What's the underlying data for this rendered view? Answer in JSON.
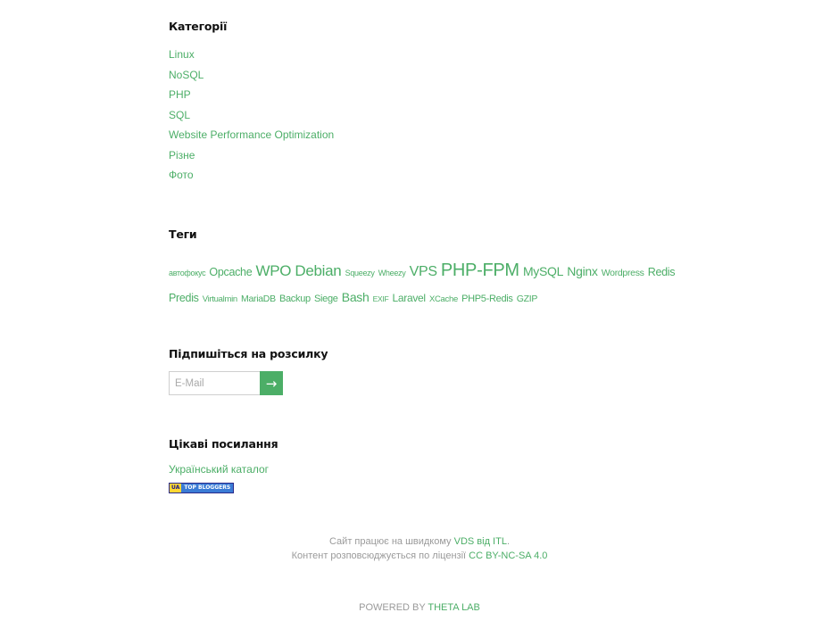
{
  "categories": {
    "title": "Категорії",
    "items": [
      "Linux",
      "NoSQL",
      "PHP",
      "SQL",
      "Website Performance Optimization",
      "Різне",
      "Фото"
    ]
  },
  "tags": {
    "title": "Теги",
    "items": [
      {
        "label": "автофокус",
        "size": 9
      },
      {
        "label": "Opcache",
        "size": 12.5
      },
      {
        "label": "WPO",
        "size": 17
      },
      {
        "label": "Debian",
        "size": 17
      },
      {
        "label": "Squeezy",
        "size": 9
      },
      {
        "label": "Wheezy",
        "size": 9
      },
      {
        "label": "VPS",
        "size": 16
      },
      {
        "label": "PHP-FPM",
        "size": 20
      },
      {
        "label": "MySQL",
        "size": 14
      },
      {
        "label": "Nginx",
        "size": 14
      },
      {
        "label": "Wordpress",
        "size": 10.5
      },
      {
        "label": "Redis",
        "size": 12.5
      },
      {
        "label": "Predis",
        "size": 12.5
      },
      {
        "label": "Virtualmin",
        "size": 9.5
      },
      {
        "label": "MariaDB",
        "size": 10.5
      },
      {
        "label": "Backup",
        "size": 11
      },
      {
        "label": "Siege",
        "size": 11
      },
      {
        "label": "Bash",
        "size": 14
      },
      {
        "label": "EXIF",
        "size": 8.5
      },
      {
        "label": "Laravel",
        "size": 12
      },
      {
        "label": "XCache",
        "size": 9.5
      },
      {
        "label": "PHP5-Redis",
        "size": 11
      },
      {
        "label": "GZIP",
        "size": 10.5
      }
    ]
  },
  "subscribe": {
    "title": "Підпишіться на розсилку",
    "placeholder": "E-Mail",
    "button_label": "→"
  },
  "links": {
    "title": "Цікаві посилання",
    "catalog_label": "Український каталог",
    "badge_left": "UA",
    "badge_right": "TOP BLOGGERS"
  },
  "footer": {
    "line1_prefix": "Сайт працює на швидкому ",
    "line1_link": "VDS від ITL",
    "line1_suffix": ".",
    "line2_prefix": "Контент розповсюджується по ліцензії ",
    "line2_link": "CC BY-NC-SA 4.0",
    "powered_prefix": "POWERED BY ",
    "powered_link": "THETA LAB"
  },
  "colors": {
    "accent": "#4cae67",
    "muted": "#9a9a9a"
  }
}
